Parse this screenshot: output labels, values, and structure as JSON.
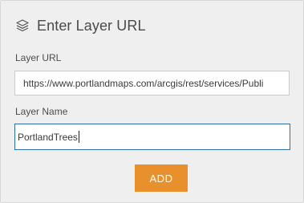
{
  "header": {
    "icon": "layers-icon",
    "title": "Enter Layer URL"
  },
  "form": {
    "url_label": "Layer URL",
    "url_value": "https://www.portlandmaps.com/arcgis/rest/services/Publi",
    "name_label": "Layer Name",
    "name_value": "PortlandTrees"
  },
  "actions": {
    "add_label": "ADD"
  },
  "colors": {
    "panel_background": "#efefef",
    "accent_button": "#e8902c",
    "focused_border": "#2f6f9f"
  }
}
